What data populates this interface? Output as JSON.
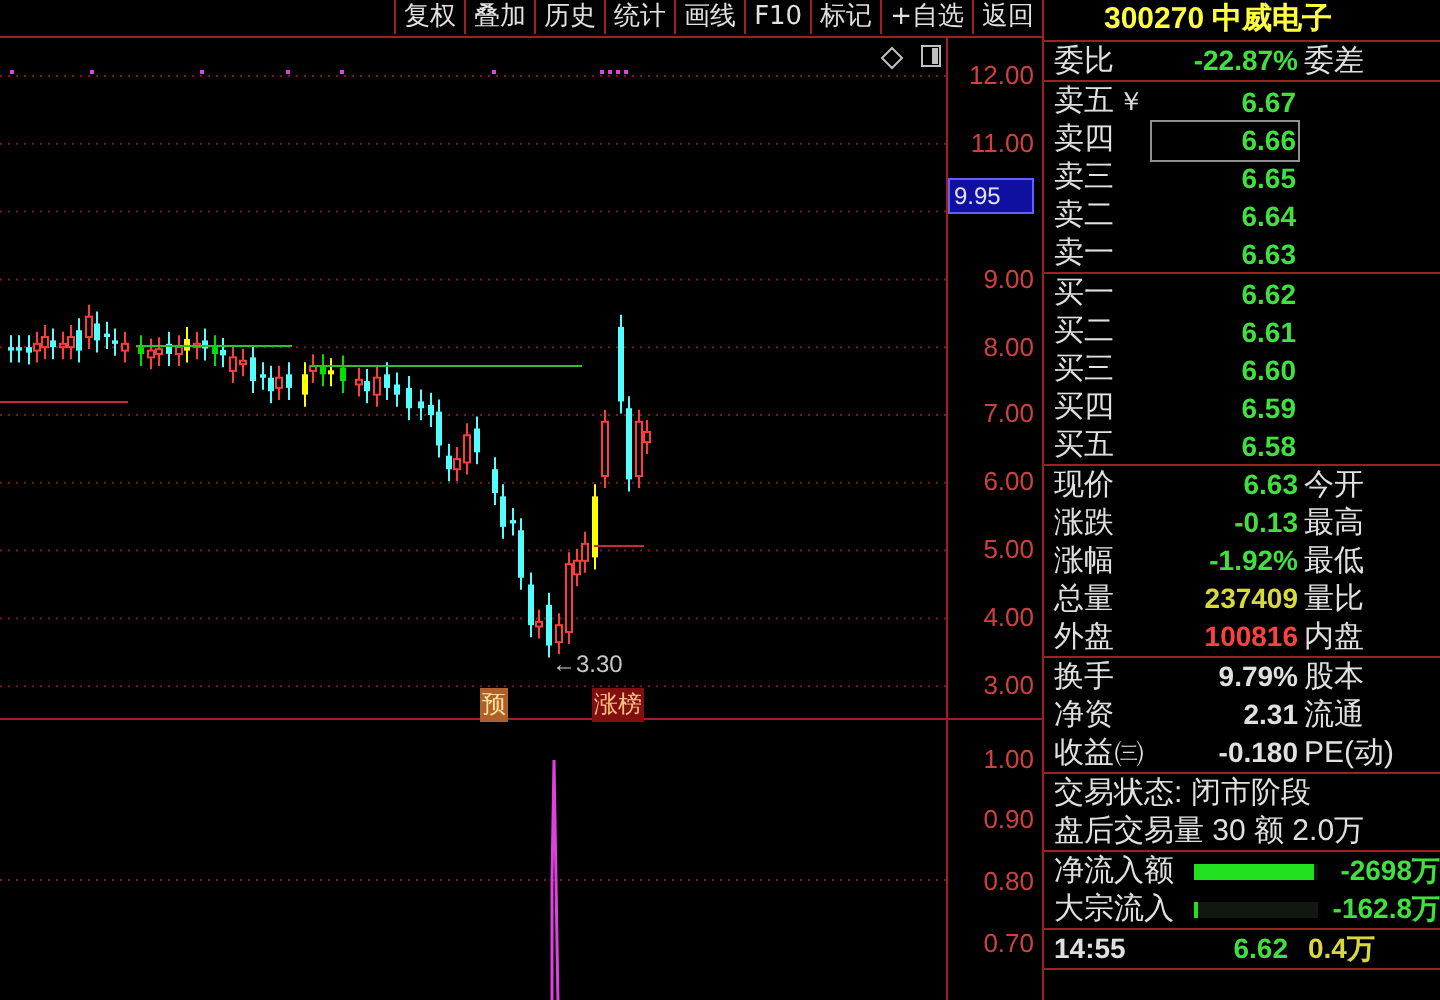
{
  "toolbar": {
    "buttons": [
      "复权",
      "叠加",
      "历史",
      "统计",
      "画线",
      "F10",
      "标记",
      "+自选",
      "返回"
    ]
  },
  "price_chart": {
    "axis_labels": [
      "12.00",
      "11.00",
      "9.00",
      "8.00",
      "7.00",
      "6.00",
      "5.00",
      "4.00",
      "3.00"
    ],
    "current_price_marker": "9.95",
    "low_label": "←3.30",
    "markers": [
      {
        "text": "预",
        "kind": "forecast"
      },
      {
        "text": "涨榜",
        "kind": "ranking"
      }
    ]
  },
  "indicator_chart": {
    "axis_labels": [
      "1.00",
      "0.90",
      "0.80",
      "0.70"
    ]
  },
  "quote_panel": {
    "code": "300270",
    "name": "中威电子",
    "order_ratio": {
      "label": "委比",
      "value": "-22.87%",
      "label2": "委差"
    },
    "asks": [
      {
        "label": "卖五",
        "marker": "￥",
        "value": "6.67",
        "selected": false
      },
      {
        "label": "卖四",
        "value": "6.66",
        "selected": true
      },
      {
        "label": "卖三",
        "value": "6.65",
        "selected": false
      },
      {
        "label": "卖二",
        "value": "6.64",
        "selected": false
      },
      {
        "label": "卖一",
        "value": "6.63",
        "selected": false
      }
    ],
    "bids": [
      {
        "label": "买一",
        "value": "6.62",
        "selected": false
      },
      {
        "label": "买二",
        "value": "6.61",
        "selected": false
      },
      {
        "label": "买三",
        "value": "6.60",
        "selected": false
      },
      {
        "label": "买四",
        "value": "6.59",
        "selected": false
      },
      {
        "label": "买五",
        "value": "6.58",
        "selected": false
      }
    ],
    "quote": [
      {
        "label": "现价",
        "value": "6.63",
        "label2": "今开",
        "color": "#40e040"
      },
      {
        "label": "涨跌",
        "value": "-0.13",
        "label2": "最高",
        "color": "#40e040"
      },
      {
        "label": "涨幅",
        "value": "-1.92%",
        "label2": "最低",
        "color": "#40e040"
      },
      {
        "label": "总量",
        "value": "237409",
        "label2": "量比",
        "color": "#d8d840"
      },
      {
        "label": "外盘",
        "value": "100816",
        "label2": "内盘",
        "color": "#ff4040"
      }
    ],
    "finance": [
      {
        "label": "换手",
        "value": "9.79%",
        "label2": "股本"
      },
      {
        "label": "净资",
        "value": "2.31",
        "label2": "流通"
      },
      {
        "label": "收益㈢",
        "value": "-0.180",
        "label2": "PE(动)"
      }
    ],
    "status": [
      "交易状态: 闭市阶段",
      "盘后交易量 30 额 2.0万"
    ],
    "flows": [
      {
        "label": "净流入额",
        "level": 0.97,
        "value": "-2698万"
      },
      {
        "label": "大宗流入",
        "level": 0.04,
        "value": "-162.8万"
      }
    ],
    "ticks": [
      {
        "time": "14:55",
        "price": "6.62",
        "volume": "0.4万"
      }
    ]
  }
}
